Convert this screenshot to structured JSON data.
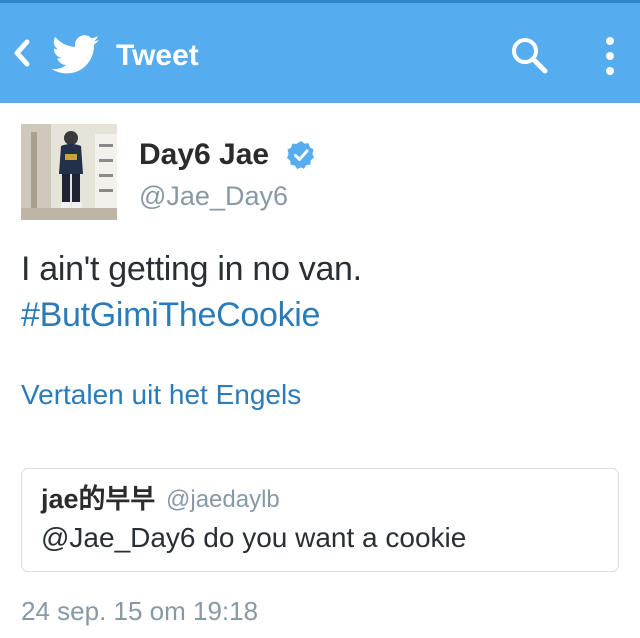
{
  "appbar": {
    "title": "Tweet",
    "bg_color": "#55acee",
    "back_icon": "chevron-left-icon",
    "logo_icon": "twitter-bird-icon",
    "search_icon": "search-icon",
    "overflow_icon": "more-vert-icon"
  },
  "tweet": {
    "author": {
      "display_name": "Day6 Jae",
      "handle": "@Jae_Day6",
      "verified": true
    },
    "text_line1": "I ain't getting in no van.",
    "hashtag": "#ButGimiTheCookie",
    "translate_label": "Vertalen uit het Engels",
    "timestamp": "24 sep. 15 om 19:18"
  },
  "quoted_tweet": {
    "display_name": "jae的부부",
    "handle": "@jaedaylb",
    "text": "@Jae_Day6 do you want a cookie"
  },
  "colors": {
    "link": "#2b7bb9",
    "secondary_text": "#8899a6",
    "primary_text": "#292f33"
  }
}
